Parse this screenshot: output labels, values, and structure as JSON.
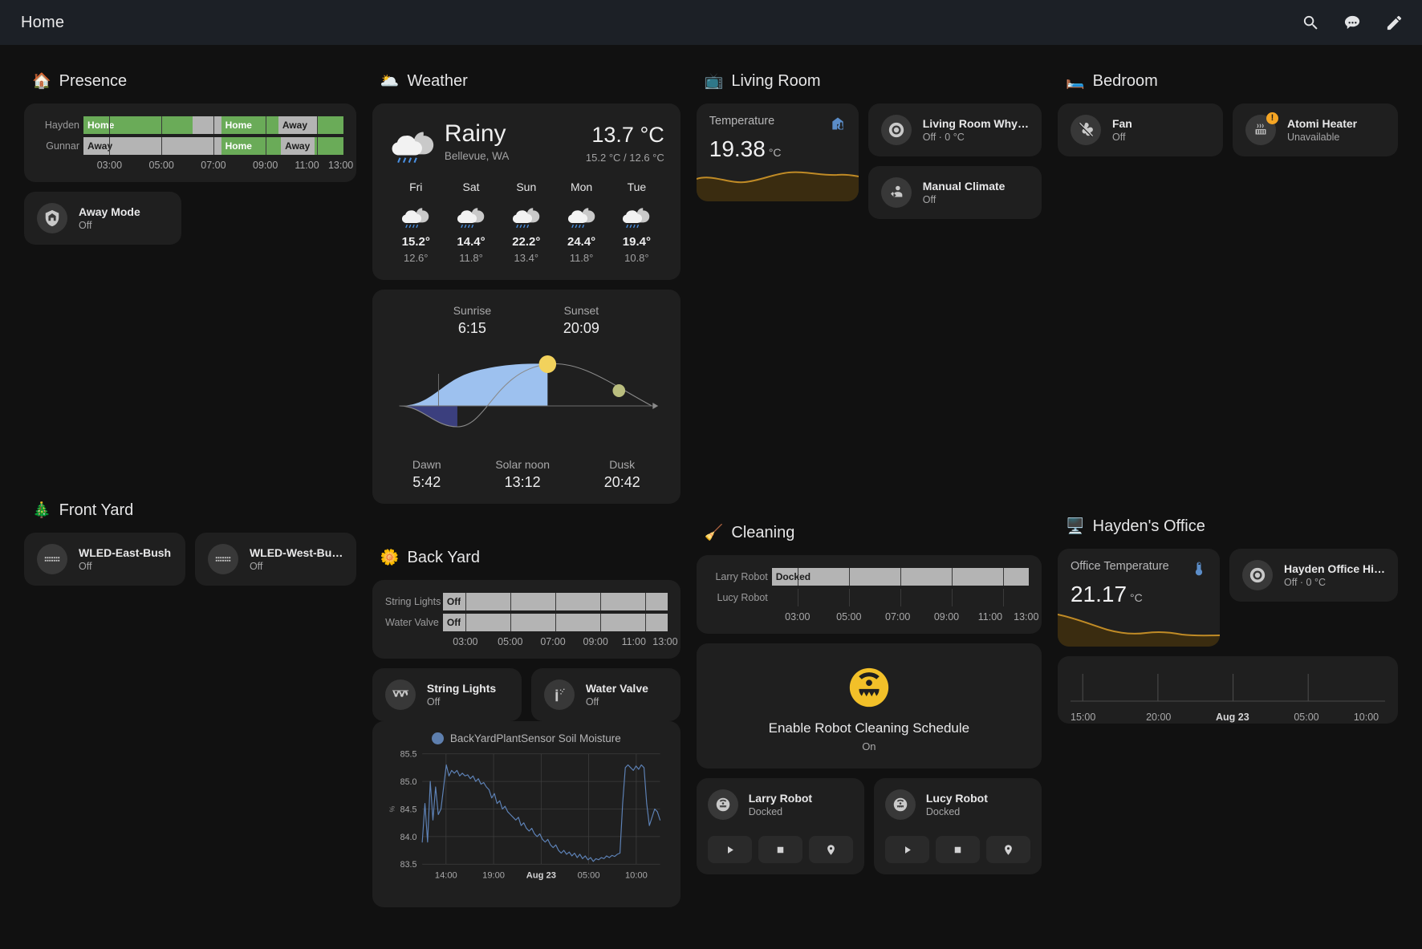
{
  "topbar": {
    "title": "Home",
    "icons": [
      {
        "name": "search-icon",
        "glyph": "search"
      },
      {
        "name": "assist-icon",
        "glyph": "assist"
      },
      {
        "name": "edit-icon",
        "glyph": "pencil"
      }
    ]
  },
  "sections": {
    "presence": {
      "emoji": "🏠",
      "title": "Presence",
      "timeline": {
        "rows": [
          {
            "label": "Hayden",
            "segments": [
              {
                "state": "Home",
                "kind": "green",
                "pct": 42
              },
              {
                "state": "",
                "kind": "grey",
                "pct": 11
              },
              {
                "state": "Home",
                "kind": "green",
                "pct": 22
              },
              {
                "state": "Away",
                "kind": "grey",
                "pct": 15
              },
              {
                "state": "",
                "kind": "green",
                "pct": 10
              }
            ]
          },
          {
            "label": "Gunnar",
            "segments": [
              {
                "state": "Away",
                "kind": "grey",
                "pct": 53
              },
              {
                "state": "Home",
                "kind": "green",
                "pct": 23
              },
              {
                "state": "Away",
                "kind": "grey",
                "pct": 13
              },
              {
                "state": "",
                "kind": "green",
                "pct": 11
              }
            ]
          }
        ],
        "ticks": [
          "03:00",
          "05:00",
          "07:00",
          "09:00",
          "11:00",
          "13:00"
        ]
      },
      "tiles": [
        {
          "name": "Away Mode",
          "state": "Off",
          "icon": "shield-home-icon"
        }
      ]
    },
    "weather": {
      "emoji": "🌥️",
      "title": "Weather",
      "current": {
        "condition": "Rainy",
        "location": "Bellevue, WA",
        "temperature": "13.7 °C",
        "range": "15.2 °C / 12.6 °C",
        "icon": "rainy-icon"
      },
      "forecast": [
        {
          "day": "Fri",
          "icon": "rainy-icon",
          "high": "15.2°",
          "low": "12.6°"
        },
        {
          "day": "Sat",
          "icon": "rainy-icon",
          "high": "14.4°",
          "low": "11.8°"
        },
        {
          "day": "Sun",
          "icon": "rainy-icon",
          "high": "22.2°",
          "low": "13.4°"
        },
        {
          "day": "Mon",
          "icon": "rainy-icon",
          "high": "24.4°",
          "low": "11.8°"
        },
        {
          "day": "Tue",
          "icon": "rainy-icon",
          "high": "19.4°",
          "low": "10.8°"
        }
      ],
      "sun": {
        "sunrise_label": "Sunrise",
        "sunrise_value": "6:15",
        "sunset_label": "Sunset",
        "sunset_value": "20:09",
        "dawn_label": "Dawn",
        "dawn_value": "5:42",
        "noon_label": "Solar noon",
        "noon_value": "13:12",
        "dusk_label": "Dusk",
        "dusk_value": "20:42"
      }
    },
    "living_room": {
      "emoji": "📺",
      "title": "Living Room",
      "sensor": {
        "name": "Temperature",
        "value": "19.38",
        "unit": "°C",
        "icon": "home-thermometer-icon"
      },
      "tiles": [
        {
          "name": "Living Room Why…",
          "state": "Off · 0 °C",
          "icon": "vacuum-icon"
        },
        {
          "name": "Manual Climate",
          "state": "Off",
          "icon": "account-arrow-icon"
        }
      ]
    },
    "bedroom": {
      "emoji": "🛏️",
      "title": "Bedroom",
      "tiles": [
        {
          "name": "Fan",
          "state": "Off",
          "icon": "fan-off-icon",
          "warn": false
        },
        {
          "name": "Atomi Heater",
          "state": "Unavailable",
          "icon": "heater-icon",
          "warn": true
        }
      ]
    },
    "front_yard": {
      "emoji": "🎄",
      "title": "Front Yard",
      "tiles": [
        {
          "name": "WLED-East-Bush",
          "state": "Off",
          "icon": "led-strip-icon"
        },
        {
          "name": "WLED-West-Bush",
          "state": "Off",
          "icon": "led-strip-icon"
        }
      ]
    },
    "back_yard": {
      "emoji": "🌼",
      "title": "Back Yard",
      "timeline": {
        "rows": [
          {
            "label": "String Lights",
            "segments": [
              {
                "state": "Off",
                "kind": "grey",
                "pct": 100
              }
            ]
          },
          {
            "label": "Water Valve",
            "segments": [
              {
                "state": "Off",
                "kind": "grey",
                "pct": 100
              }
            ]
          }
        ],
        "ticks": [
          "03:00",
          "05:00",
          "07:00",
          "09:00",
          "11:00",
          "13:00"
        ]
      },
      "tiles": [
        {
          "name": "String Lights",
          "state": "Off",
          "icon": "string-lights-icon"
        },
        {
          "name": "Water Valve",
          "state": "Off",
          "icon": "sprinkler-icon"
        }
      ]
    },
    "cleaning": {
      "emoji": "🧹",
      "title": "Cleaning",
      "timeline": {
        "rows": [
          {
            "label": "Larry Robot",
            "segments": [
              {
                "state": "Docked",
                "kind": "grey",
                "pct": 100
              }
            ]
          },
          {
            "label": "Lucy Robot",
            "segments": [
              {
                "state": "",
                "kind": "empty",
                "pct": 100
              }
            ]
          }
        ],
        "ticks": [
          "03:00",
          "05:00",
          "07:00",
          "09:00",
          "11:00",
          "13:00"
        ]
      },
      "schedule_button": {
        "name": "Enable Robot Cleaning Schedule",
        "state": "On",
        "icon": "robot-vacuum-icon",
        "color": "#f2c029"
      },
      "vacuums": [
        {
          "name": "Larry Robot",
          "state": "Docked",
          "icon": "robot-vacuum-icon",
          "buttons": [
            {
              "name": "play-button",
              "glyph": "play"
            },
            {
              "name": "stop-button",
              "glyph": "stop"
            },
            {
              "name": "locate-button",
              "glyph": "locate"
            }
          ]
        },
        {
          "name": "Lucy Robot",
          "state": "Docked",
          "icon": "robot-vacuum-icon",
          "buttons": [
            {
              "name": "play-button",
              "glyph": "play"
            },
            {
              "name": "stop-button",
              "glyph": "stop"
            },
            {
              "name": "locate-button",
              "glyph": "locate"
            }
          ]
        }
      ]
    },
    "hayden_office": {
      "emoji": "🖥️",
      "title": "Hayden's Office",
      "sensor": {
        "name": "Office Temperature",
        "value": "21.17",
        "unit": "°C",
        "icon": "thermometer-icon"
      },
      "tiles": [
        {
          "name": "Hayden Office Hi…",
          "state": "Off · 0 °C",
          "icon": "vacuum-icon"
        }
      ],
      "axis_ticks": [
        "15:00",
        "20:00",
        "Aug 23",
        "05:00",
        "10:00"
      ]
    }
  },
  "chart_data": {
    "type": "line",
    "title": "BackYardPlantSensor Soil Moisture",
    "legend": [
      "BackYardPlantSensor Soil Moisture"
    ],
    "legend_position": "top-center",
    "grid": true,
    "ylabel": "%",
    "xlabel": "",
    "ylim": [
      83.5,
      85.5
    ],
    "yticks": [
      83.5,
      84.0,
      84.5,
      85.0,
      85.5
    ],
    "xticks": [
      "14:00",
      "19:00",
      "Aug 23",
      "05:00",
      "10:00"
    ],
    "series": [
      {
        "name": "BackYardPlantSensor Soil Moisture",
        "color": "#5e83b8",
        "values": [
          83.9,
          84.6,
          83.9,
          85.0,
          84.3,
          84.9,
          84.4,
          84.5,
          84.9,
          85.3,
          85.1,
          85.2,
          85.15,
          85.2,
          85.1,
          85.15,
          85.1,
          85.12,
          85.05,
          85.1,
          85.0,
          85.05,
          84.95,
          84.98,
          84.9,
          84.85,
          84.7,
          84.78,
          84.6,
          84.65,
          84.5,
          84.55,
          84.45,
          84.4,
          84.35,
          84.3,
          84.35,
          84.2,
          84.25,
          84.15,
          84.1,
          84.15,
          84.05,
          84.0,
          84.05,
          83.95,
          83.9,
          83.95,
          83.85,
          83.8,
          83.85,
          83.75,
          83.7,
          83.75,
          83.68,
          83.72,
          83.65,
          83.7,
          83.62,
          83.68,
          83.6,
          83.65,
          83.58,
          83.62,
          83.55,
          83.6,
          83.58,
          83.62,
          83.6,
          83.65,
          83.62,
          83.66,
          83.64,
          83.68,
          83.7,
          84.6,
          85.25,
          85.3,
          85.25,
          85.2,
          85.28,
          85.22,
          85.3,
          85.25,
          84.6,
          84.2,
          84.35,
          84.5,
          84.45,
          84.3
        ]
      }
    ]
  }
}
